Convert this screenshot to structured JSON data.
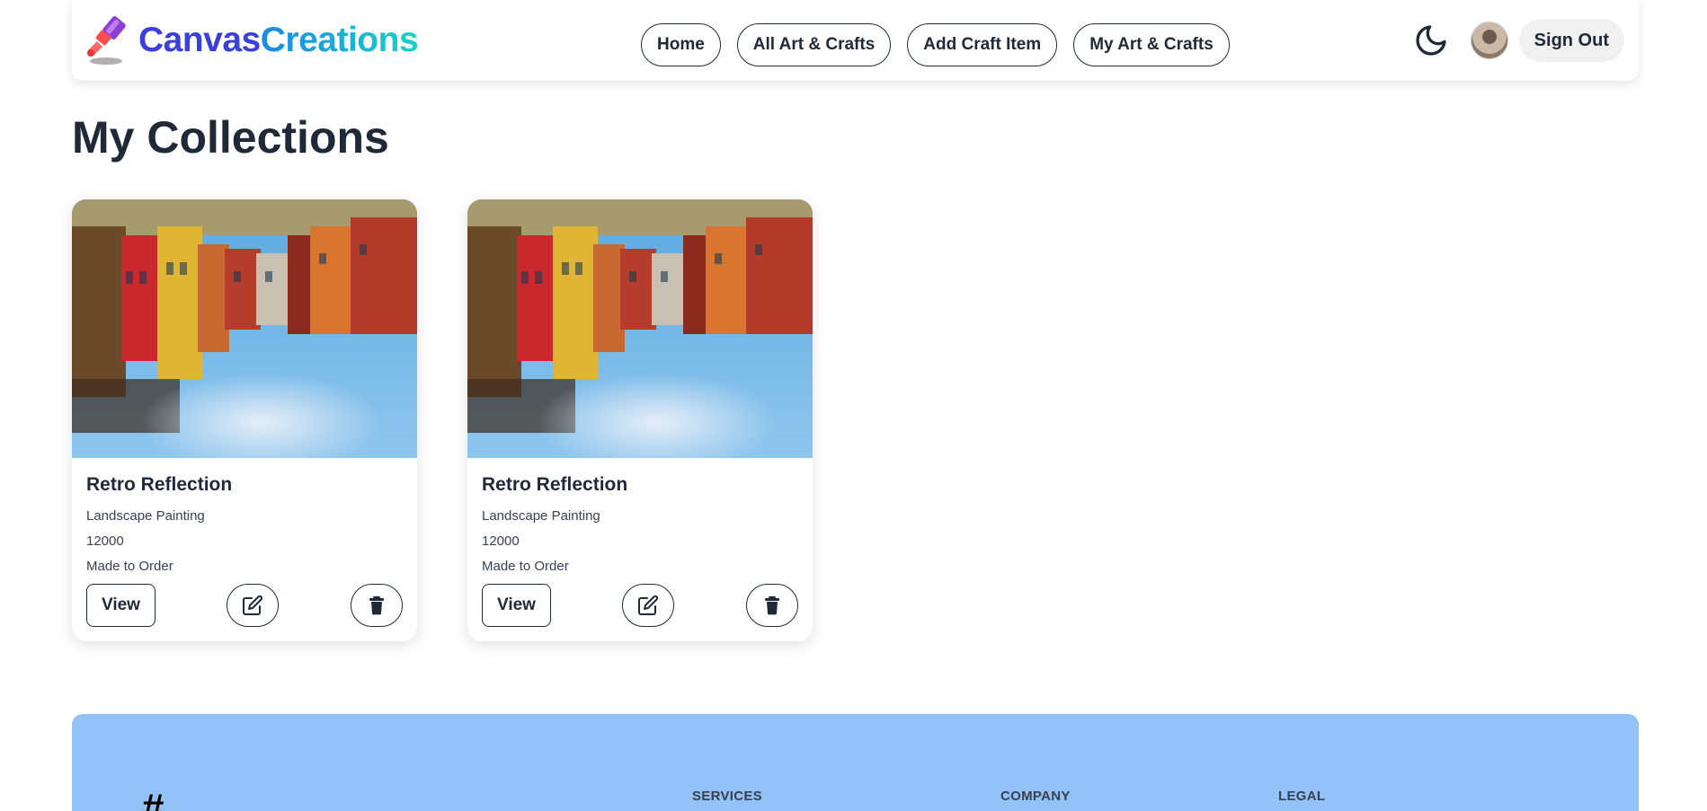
{
  "navbar": {
    "brand_part1": "Canvas",
    "brand_part2": "Creations",
    "links": [
      "Home",
      "All Art & Crafts",
      "Add Craft Item",
      "My Art & Crafts"
    ],
    "theme_icon": "moon-icon",
    "signout_label": "Sign Out"
  },
  "page": {
    "title": "My Collections"
  },
  "cards": [
    {
      "title": "Retro Reflection",
      "category": "Landscape Painting",
      "price": "12000",
      "status": "Made to Order",
      "view_label": "View",
      "edit_icon": "edit-icon",
      "delete_icon": "trash-icon"
    },
    {
      "title": "Retro Reflection",
      "category": "Landscape Painting",
      "price": "12000",
      "status": "Made to Order",
      "view_label": "View",
      "edit_icon": "edit-icon",
      "delete_icon": "trash-icon"
    }
  ],
  "footer": {
    "logo_glyph": "#",
    "headings": [
      "SERVICES",
      "COMPANY",
      "LEGAL"
    ]
  },
  "colors": {
    "brand_primary": "#3b3fdc",
    "brand_gradient_start": "#1e88e5",
    "brand_gradient_end": "#14d4c8",
    "footer_bg": "#92c2f8",
    "text_dark": "#1f2937"
  }
}
